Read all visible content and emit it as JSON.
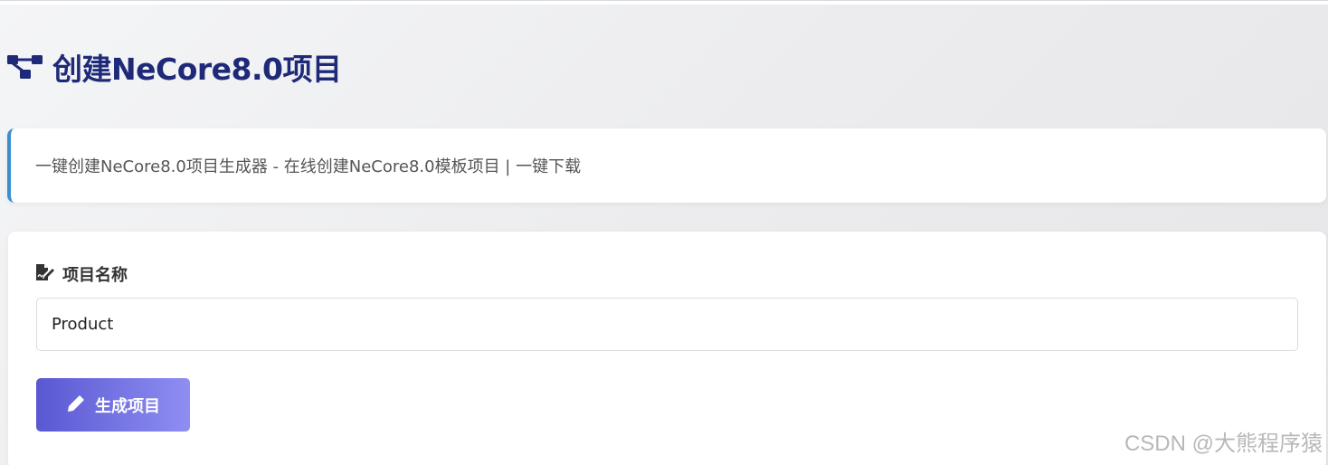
{
  "header": {
    "title": "创建NeCore8.0项目",
    "icon": "project-diagram-icon"
  },
  "banner": {
    "text": "一键创建NeCore8.0项目生成器 - 在线创建NeCore8.0模板项目 | 一键下载"
  },
  "form": {
    "project_name_label": "项目名称",
    "project_name_icon": "file-signature-icon",
    "project_name_value": "Product",
    "generate_button_label": "生成项目",
    "generate_button_icon": "pen-icon"
  },
  "watermark": {
    "text": "CSDN @大熊程序猿"
  },
  "colors": {
    "title": "#1e2a78",
    "banner_accent": "#3a8fd0",
    "button_gradient_start": "#5a58d2",
    "button_gradient_end": "#8e8ef2"
  }
}
